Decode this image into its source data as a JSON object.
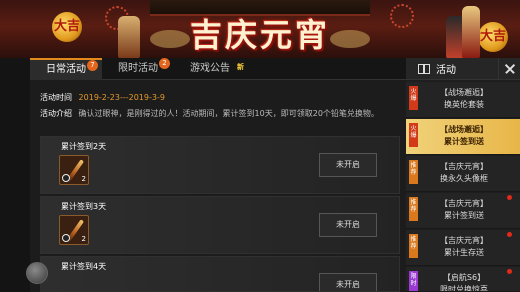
{
  "banner": {
    "title": "吉庆元宵",
    "lantern_left": "大吉",
    "lantern_right": "大吉"
  },
  "tabs": [
    {
      "label": "日常活动",
      "badge": "7"
    },
    {
      "label": "限时活动",
      "badge": "2"
    },
    {
      "label": "游戏公告",
      "badge": "新"
    }
  ],
  "activity": {
    "time_label": "活动时间",
    "time_value": "2019-2-23---2019-3-9",
    "desc_label": "活动介绍",
    "desc_value": "确认过眼神，是刚得过的人！活动期间，累计签到10天，即可领取20个铅笔兑换物。"
  },
  "rewards": [
    {
      "title": "累计签到2天",
      "count": "2",
      "status": "未开启"
    },
    {
      "title": "累计签到3天",
      "count": "2",
      "status": "未开启"
    },
    {
      "title": "累计签到4天",
      "count": "",
      "status": "未开启"
    }
  ],
  "sidebar": {
    "title": "活动",
    "items": [
      {
        "tag": "火爆",
        "line1": "【战场邂逅】",
        "line2": "换英伦套装",
        "active": false,
        "dot": false
      },
      {
        "tag": "火爆",
        "line1": "【战场邂逅】",
        "line2": "累计签到送",
        "active": true,
        "dot": false
      },
      {
        "tag": "推荐",
        "line1": "【吉庆元宵】",
        "line2": "换永久头像框",
        "active": false,
        "dot": false
      },
      {
        "tag": "推荐",
        "line1": "【吉庆元宵】",
        "line2": "累计签到送",
        "active": false,
        "dot": true
      },
      {
        "tag": "推荐",
        "line1": "【吉庆元宵】",
        "line2": "累计生存送",
        "active": false,
        "dot": true
      },
      {
        "tag": "限时",
        "line1": "【启航S6】",
        "line2": "限时兑换惊喜",
        "active": false,
        "dot": true
      }
    ]
  }
}
